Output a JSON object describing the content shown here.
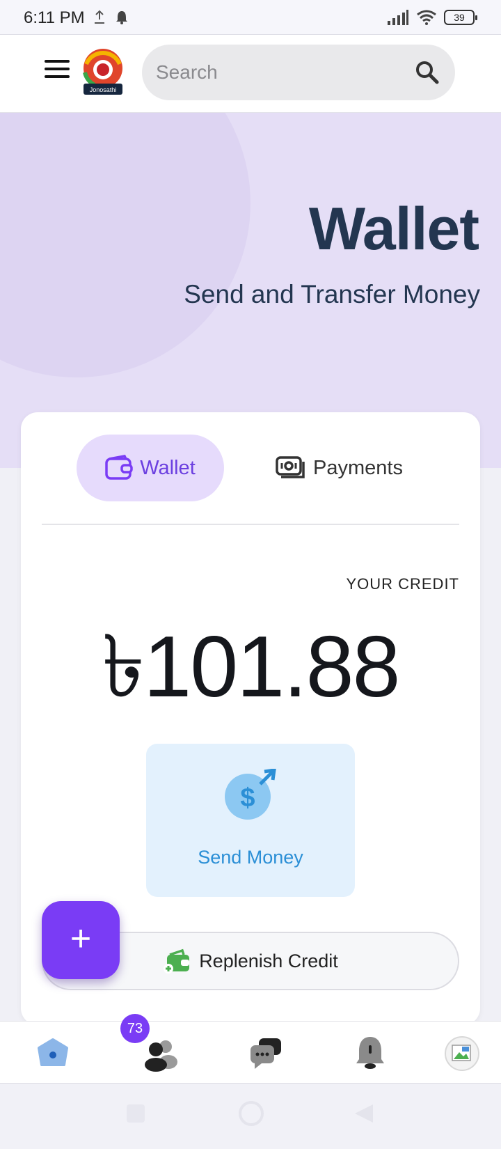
{
  "status_bar": {
    "time": "6:11 PM",
    "battery": "39"
  },
  "header": {
    "logo_text": "Jonosathi",
    "search_placeholder": "Search"
  },
  "hero": {
    "title": "Wallet",
    "subtitle": "Send and Transfer Money"
  },
  "tabs": [
    {
      "label": "Wallet",
      "active": true
    },
    {
      "label": "Payments",
      "active": false
    }
  ],
  "credit": {
    "label": "YOUR CREDIT",
    "amount": "৳101.88"
  },
  "actions": {
    "send_money": "Send Money",
    "replenish_credit": "Replenish Credit"
  },
  "bottom_nav": {
    "people_badge": "73",
    "items": [
      "home-icon",
      "people-icon",
      "chat-icon",
      "bell-icon",
      "avatar"
    ]
  },
  "colors": {
    "accent": "#7a3cf5",
    "hero_bg": "#e5def6",
    "title": "#233650",
    "send_blue": "#2b8fd6",
    "replenish_green": "#4caf50"
  }
}
